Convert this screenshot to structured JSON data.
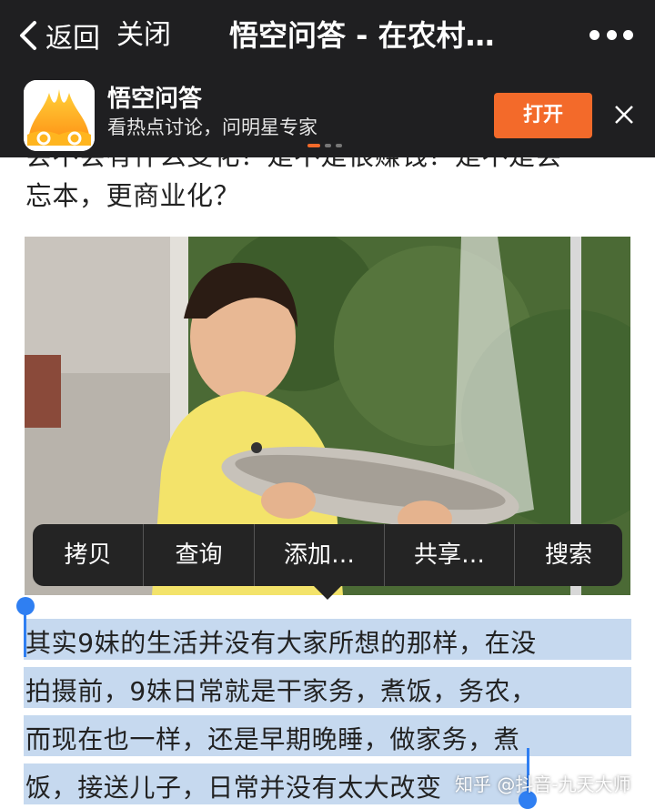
{
  "navbar": {
    "back_label": "返回",
    "close_label": "关闭",
    "title": "悟空问答 - 在农村…"
  },
  "banner": {
    "app_name": "悟空问答",
    "description": "看热点讨论，问明星专家",
    "open_label": "打开"
  },
  "article": {
    "cut_line": "会不会有什么变化？是不是很赚钱？是不是会",
    "line2": "忘本，更商业化？"
  },
  "context_menu": {
    "items": [
      "拷贝",
      "查询",
      "添加…",
      "共享…",
      "搜索"
    ]
  },
  "selected_text": {
    "lines": [
      "其实9妹的生活并没有大家所想的那样，在没",
      "拍摄前，9妹日常就是干家务，煮饭，务农，",
      "而现在也一样，还是早期晚睡，做家务，煮",
      "饭，接送儿子，日常并没有太大改变"
    ]
  },
  "watermark": "知乎 @抖音-九天大师",
  "colors": {
    "navbar_bg": "#1f1f21",
    "accent_orange": "#f36a2a",
    "selection_bg": "#c6d9ef",
    "selection_handle": "#2f7ff2"
  },
  "icons": {
    "back": "chevron-left-icon",
    "more": "ellipsis-icon",
    "close": "close-icon",
    "logo": "wukong-cloud-logo"
  }
}
